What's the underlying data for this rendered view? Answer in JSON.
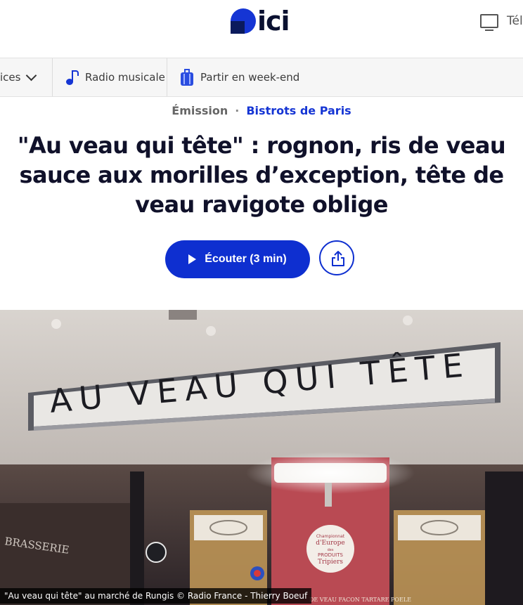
{
  "header": {
    "logo_text": "ici",
    "tv_label": "Télé",
    "brand_color": "#1535d4"
  },
  "nav": {
    "items": [
      {
        "label": "ices",
        "icon": "chevron-down-icon"
      },
      {
        "label": "Radio musicale",
        "icon": "music-note-icon"
      },
      {
        "label": "Partir en week-end",
        "icon": "suitcase-icon"
      }
    ]
  },
  "article": {
    "category": "Émission",
    "show": "Bistrots de Paris",
    "title": "\"Au veau qui tête\" : rognon, ris de veau sauce aux morilles d’exception, tête de veau ravigote oblige",
    "listen_label": "Écouter (3 min)",
    "share_icon": "share-icon"
  },
  "photo": {
    "sign_text": "AU VEAU QUI TÊTE",
    "brasserie_text": "BRASSERIE",
    "badge_lines": [
      "Championnat",
      "d'Europe",
      "des",
      "PRODUITS",
      "Tripiers"
    ],
    "shelf_text": "DE VEAU FACON TARTARE POELE",
    "caption": "\"Au veau qui tête\" au marché de Rungis © Radio France - Thierry Boeuf"
  }
}
